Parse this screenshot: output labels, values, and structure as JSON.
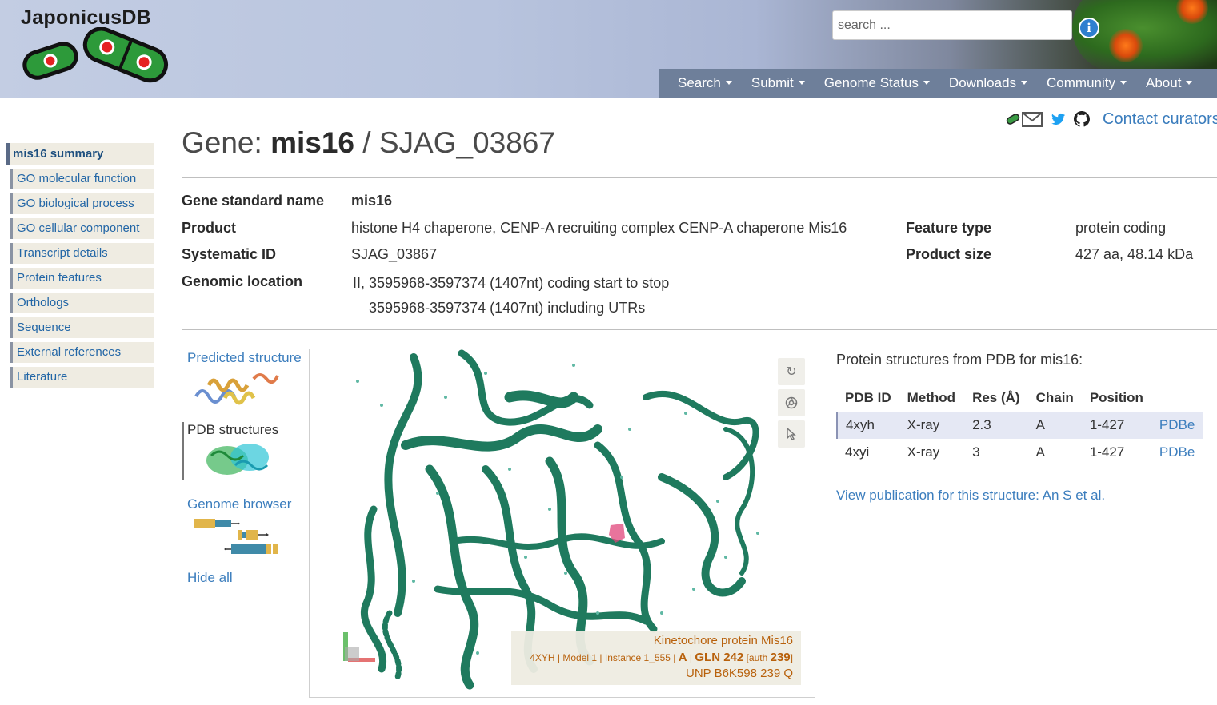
{
  "header": {
    "logo_text": "JaponicusDB",
    "search_placeholder": "search ...",
    "nav": [
      {
        "label": "Search"
      },
      {
        "label": "Submit"
      },
      {
        "label": "Genome Status"
      },
      {
        "label": "Downloads"
      },
      {
        "label": "Community"
      },
      {
        "label": "About"
      }
    ]
  },
  "contact": {
    "label": "Contact curators"
  },
  "sidebar": {
    "items": [
      {
        "label": "mis16 summary",
        "active": true
      },
      {
        "label": "GO molecular function"
      },
      {
        "label": "GO biological process"
      },
      {
        "label": "GO cellular component"
      },
      {
        "label": "Transcript details"
      },
      {
        "label": "Protein features"
      },
      {
        "label": "Orthologs"
      },
      {
        "label": "Sequence"
      },
      {
        "label": "External references"
      },
      {
        "label": "Literature"
      }
    ]
  },
  "gene": {
    "title_prefix": "Gene:",
    "name": "mis16",
    "separator": "/",
    "systematic_id": "SJAG_03867",
    "details": {
      "standard_name_label": "Gene standard name",
      "standard_name": "mis16",
      "product_label": "Product",
      "product": "histone H4 chaperone, CENP-A recruiting complex CENP-A chaperone Mis16",
      "systematic_id_label": "Systematic ID",
      "systematic_id": "SJAG_03867",
      "location_label": "Genomic location",
      "location_line1": "II, 3595968-3597374 (1407nt) coding start to stop",
      "location_line2": "3595968-3597374 (1407nt) including UTRs",
      "feature_type_label": "Feature type",
      "feature_type": "protein coding",
      "product_size_label": "Product size",
      "product_size": "427 aa, 48.14 kDa"
    }
  },
  "viewer_tabs": [
    {
      "label": "Predicted structure"
    },
    {
      "label": "PDB structures",
      "active": true
    },
    {
      "label": "Genome browser"
    },
    {
      "label": "Hide all"
    }
  ],
  "viewer": {
    "tooltip": {
      "title": "Kinetochore protein Mis16",
      "line2_prefix": "4XYH | Model 1 | Instance 1_555 |",
      "chain": "A",
      "residue": "GLN 242",
      "auth_prefix": "[auth",
      "auth_num": "239",
      "auth_suffix": "]",
      "line3": "UNP B6K598 239 Q"
    },
    "colors": {
      "ribbon": "#1f7a5e",
      "highlight": "#e0457b"
    }
  },
  "pdb": {
    "heading": "Protein structures from PDB for mis16:",
    "columns": [
      "PDB ID",
      "Method",
      "Res (Å)",
      "Chain",
      "Position",
      ""
    ],
    "rows": [
      {
        "id": "4xyh",
        "method": "X-ray",
        "res": "2.3",
        "chain": "A",
        "position": "1-427",
        "link": "PDBe"
      },
      {
        "id": "4xyi",
        "method": "X-ray",
        "res": "3",
        "chain": "A",
        "position": "1-427",
        "link": "PDBe"
      }
    ],
    "publication_link": "View publication for this structure: An S et al."
  }
}
